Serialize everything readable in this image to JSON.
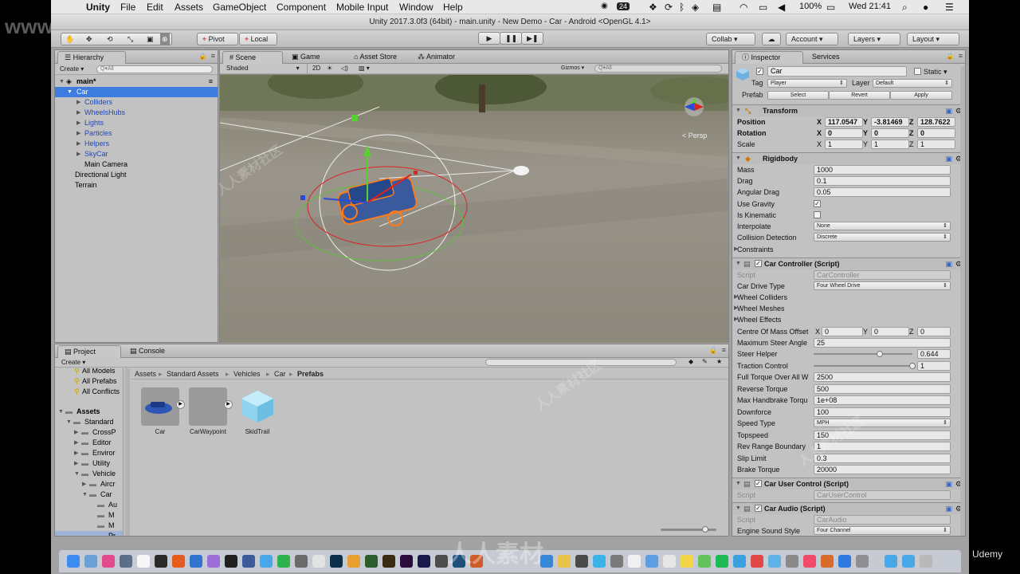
{
  "watermark_top": "www.rr-sc.com",
  "watermark_text": "人人素材社区",
  "watermark_bottom": "人人素材",
  "udemy": "Udemy",
  "menubar": {
    "apple": "",
    "app": "Unity",
    "items": [
      "File",
      "Edit",
      "Assets",
      "GameObject",
      "Component",
      "Mobile Input",
      "Window",
      "Help"
    ],
    "cal_badge": "24",
    "battery": "100%",
    "clock": "Wed 21:41"
  },
  "title": "Unity 2017.3.0f3 (64bit) - main.unity - New Demo - Car - Android <OpenGL 4.1>",
  "toolbar": {
    "pivot": "Pivot",
    "local": "Local",
    "collab": "Collab ▾",
    "account": "Account",
    "layers": "Layers",
    "layout": "Layout"
  },
  "hierarchy": {
    "tab": "Hierarchy",
    "create": "Create ▾",
    "search_placeholder": "Q▾All",
    "scene": "main*",
    "items": [
      {
        "label": "Car"
      },
      {
        "label": "Colliders"
      },
      {
        "label": "WheelsHubs"
      },
      {
        "label": "Lights"
      },
      {
        "label": "Particles"
      },
      {
        "label": "Helpers"
      },
      {
        "label": "SkyCar"
      },
      {
        "label": "Main Camera"
      },
      {
        "label": "Directional Light"
      },
      {
        "label": "Terrain"
      }
    ]
  },
  "scene": {
    "tabs": [
      "Scene",
      "Game",
      "Asset Store",
      "Animator"
    ],
    "shading": "Shaded",
    "mode2d": "2D",
    "gizmos": "Gizmos ▾",
    "search": "Q▾All",
    "persp": "< Persp"
  },
  "project": {
    "tabs": [
      "Project",
      "Console"
    ],
    "create": "Create ▾",
    "favorites": [
      "All Models",
      "All Prefabs",
      "All Conflicts"
    ],
    "tree": [
      "Assets",
      "Standard",
      "CrossP",
      "Editor",
      "Enviror",
      "Utility",
      "Vehicle",
      "Aircr",
      "Car",
      "Au",
      "M",
      "M",
      "Pr"
    ],
    "breadcrumb": [
      "Assets",
      "Standard Assets",
      "Vehicles",
      "Car",
      "Prefabs"
    ],
    "assets": [
      "Car",
      "CarWaypoint",
      "SkidTrail"
    ]
  },
  "inspector": {
    "tabs": [
      "Inspector",
      "Services"
    ],
    "object_name": "Car",
    "static": "Static",
    "tag_label": "Tag",
    "tag": "Player",
    "layer_label": "Layer",
    "layer": "Default",
    "prefab_label": "Prefab",
    "prefab_buttons": [
      "Select",
      "Revert",
      "Apply"
    ],
    "transform": {
      "title": "Transform",
      "position_label": "Position",
      "rotation_label": "Rotation",
      "scale_label": "Scale",
      "position": [
        "117.0547",
        "-3.81469",
        "128.7622"
      ],
      "rotation": [
        "0",
        "0",
        "0"
      ],
      "scale": [
        "1",
        "1",
        "1"
      ]
    },
    "rigidbody": {
      "title": "Rigidbody",
      "rows": [
        {
          "label": "Mass",
          "value": "1000"
        },
        {
          "label": "Drag",
          "value": "0.1"
        },
        {
          "label": "Angular Drag",
          "value": "0.05"
        },
        {
          "label": "Use Gravity",
          "value": ""
        },
        {
          "label": "Is Kinematic",
          "value": ""
        },
        {
          "label": "Interpolate",
          "value": "None"
        },
        {
          "label": "Collision Detection",
          "value": "Discrete"
        },
        {
          "label": "Constraints",
          "value": ""
        }
      ]
    },
    "car_controller": {
      "title": "Car Controller (Script)",
      "script_label": "Script",
      "script": "CarController",
      "drive_label": "Car Drive Type",
      "drive": "Four Wheel Drive",
      "foldouts": [
        "Wheel Colliders",
        "Wheel Meshes",
        "Wheel Effects"
      ],
      "com_label": "Centre Of Mass Offset",
      "com": [
        "0",
        "0",
        "0"
      ],
      "steer_angle_label": "Maximum Steer Angle",
      "steer_angle": "25",
      "steer_helper_label": "Steer Helper",
      "steer_helper": "0.644",
      "traction_label": "Traction Control",
      "traction": "1",
      "rows": [
        {
          "label": "Full Torque Over All W",
          "value": "2500"
        },
        {
          "label": "Reverse Torque",
          "value": "500"
        },
        {
          "label": "Max Handbrake Torqu",
          "value": "1e+08"
        },
        {
          "label": "Downforce",
          "value": "100"
        },
        {
          "label": "Speed Type",
          "value": "MPH"
        },
        {
          "label": "Topspeed",
          "value": "150"
        },
        {
          "label": "Rev Range Boundary",
          "value": "1"
        },
        {
          "label": "Slip Limit",
          "value": "0.3"
        },
        {
          "label": "Brake Torque",
          "value": "20000"
        }
      ]
    },
    "car_user_control": {
      "title": "Car User Control (Script)",
      "script_label": "Script",
      "script": "CarUserControl"
    },
    "car_audio": {
      "title": "Car Audio (Script)",
      "script_label": "Script",
      "script": "CarAudio",
      "engine_label": "Engine Sound Style",
      "engine": "Four Channel"
    }
  },
  "colors": {
    "selection": "#3e7ce0",
    "prefab_text": "#2047b8",
    "ground": "#8f8a7d"
  }
}
